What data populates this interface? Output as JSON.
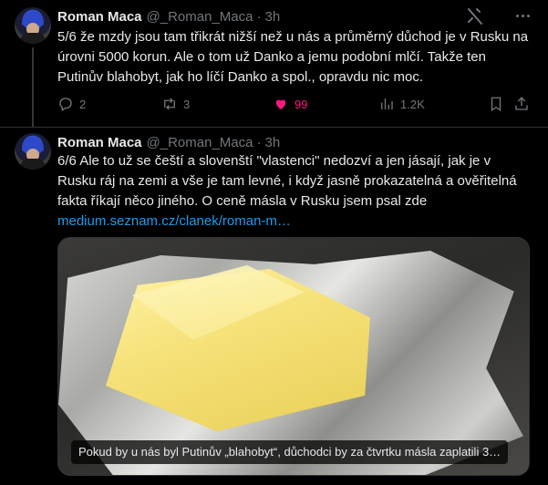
{
  "tweets": [
    {
      "author_name": "Roman Maca",
      "author_handle": "@_Roman_Maca",
      "separator": "·",
      "time": "3h",
      "text": "5/6 že mzdy jsou tam třikrát nižší než u nás a průměrný důchod je v Rusku na úrovni 5000 korun. Ale o tom už Danko a jemu podobní mlčí. Takže ten Putinův blahobyt, jak ho líčí Danko a spol., opravdu nic moc.",
      "actions": {
        "replies": "2",
        "retweets": "3",
        "likes": "99",
        "views": "1.2K"
      },
      "liked": true
    },
    {
      "author_name": "Roman Maca",
      "author_handle": "@_Roman_Maca",
      "separator": "·",
      "time": "3h",
      "text": "6/6 Ale to už se čeští a slovenští \"vlastenci\" nedozví a jen jásají, jak je v Rusku ráj na zemi a vše je tam levné, i když jasně prokazatelná a ověřitelná fakta říkají něco jiného. O ceně másla v Rusku jsem psal zde",
      "link": "medium.seznam.cz/clanek/roman-m…",
      "media_caption": "Pokud by u nás byl Putinův „blahobyt“, důchodci by za čtvrtku másla zaplatili 3…"
    }
  ],
  "icons": {
    "grok": "grok-icon",
    "more": "more-icon",
    "reply": "reply-icon",
    "retweet": "retweet-icon",
    "like": "heart-icon",
    "views": "views-icon",
    "bookmark": "bookmark-icon",
    "share": "share-icon"
  },
  "colors": {
    "background": "#000000",
    "text": "#e7e9ea",
    "muted": "#71767b",
    "link": "#1d9bf0",
    "like": "#f91880",
    "divider": "#2f3336"
  }
}
